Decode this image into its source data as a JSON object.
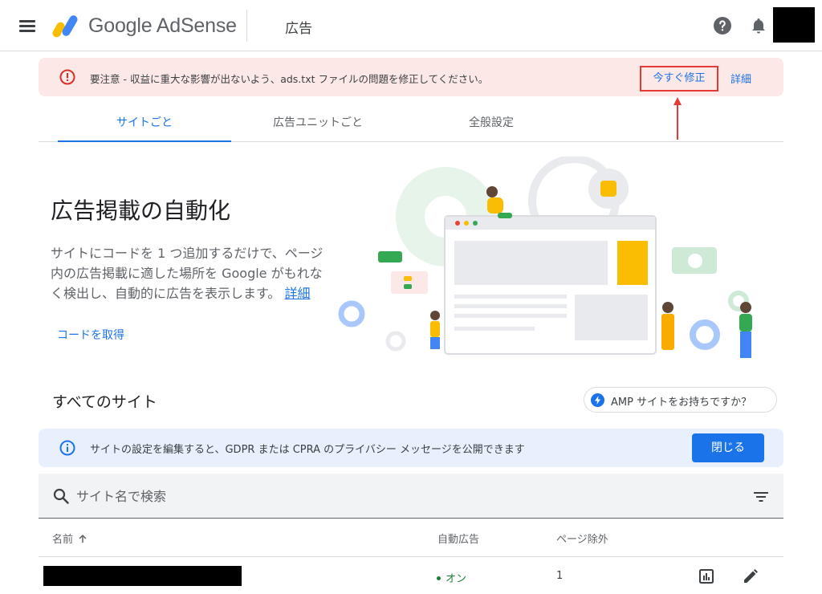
{
  "header": {
    "brand": "Google AdSense",
    "page_title": "広告",
    "icons": [
      "menu-icon",
      "help-icon",
      "bell-icon"
    ]
  },
  "warning": {
    "text": "要注意 - 収益に重大な影響が出ないよう、ads.txt ファイルの問題を修正してください。",
    "fix_label": "今すぐ修正",
    "detail_label": "詳細",
    "color": "#fce8e6"
  },
  "tabs": [
    {
      "label": "サイトごと",
      "active": true
    },
    {
      "label": "広告ユニットごと",
      "active": false
    },
    {
      "label": "全般設定",
      "active": false
    }
  ],
  "hero": {
    "title": "広告掲載の自動化",
    "description": "サイトにコードを 1 つ追加するだけで、ページ内の広告掲載に適した場所を Google がもれなく検出し、自動的に広告を表示します。",
    "description_link": "詳細",
    "get_code": "コードを取得"
  },
  "sites": {
    "heading": "すべてのサイト",
    "amp_chip": "AMP サイトをお持ちですか？"
  },
  "info_banner": {
    "text": "サイトの設定を編集すると、GDPR または CPRA のプライバシー メッセージを公開できます",
    "close_label": "閉じる"
  },
  "search": {
    "placeholder": "サイト名で検索"
  },
  "table": {
    "columns": [
      "名前",
      "自動広告",
      "ページ除外"
    ],
    "rows": [
      {
        "status": "オン",
        "exclusions": "1"
      }
    ]
  },
  "colors": {
    "accent": "#1a73e8",
    "status_on": "#188038",
    "warning_red": "#d93025"
  }
}
